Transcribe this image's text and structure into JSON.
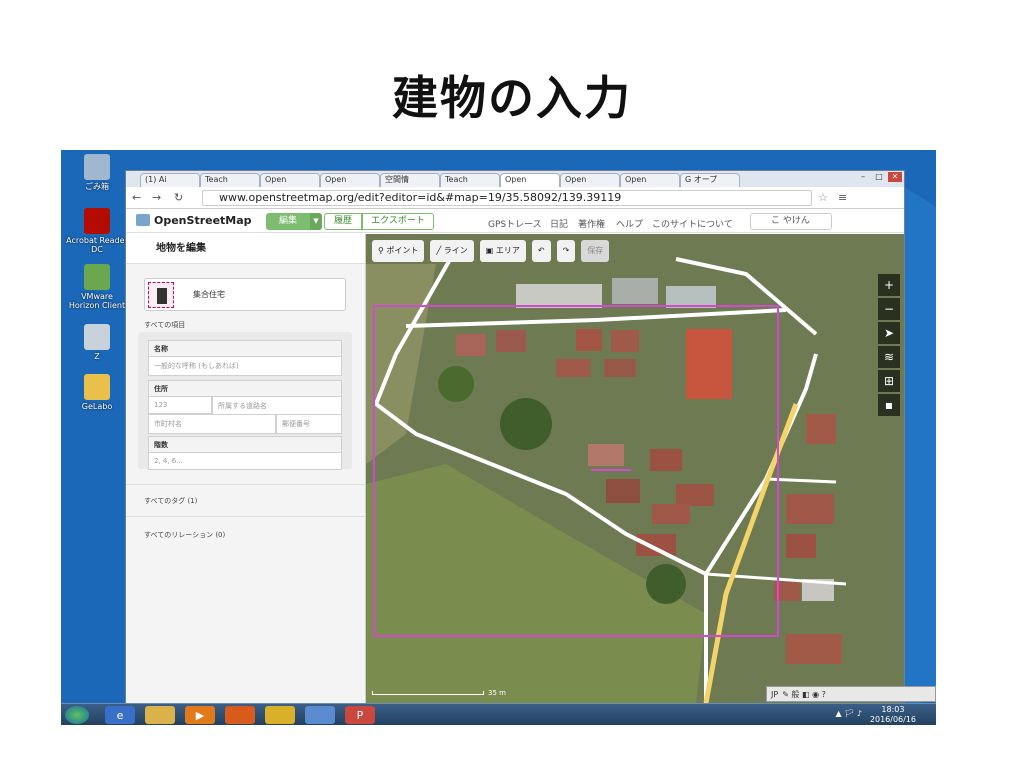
{
  "slide": {
    "title": "建物の入力"
  },
  "desktop": {
    "icons": [
      {
        "label": "ごみ箱",
        "icon": "recycle-bin-icon",
        "color": "#9fb8d0"
      },
      {
        "label": "Acrobat Reader DC",
        "icon": "acrobat-icon",
        "color": "#b30b00"
      },
      {
        "label": "VMware Horizon Client",
        "icon": "vmware-icon",
        "color": "#6aa84f"
      },
      {
        "label": "Z",
        "icon": "network-drive-icon",
        "color": "#c9d2da"
      },
      {
        "label": "GeLabo",
        "icon": "folder-icon",
        "color": "#e8c04a"
      }
    ]
  },
  "taskbar": {
    "clock_time": "18:03",
    "clock_date": "2016/06/16",
    "tray_text": "▲ 🏳 ♪",
    "ime_label": "JP"
  },
  "browser": {
    "tabs": [
      {
        "label": "(1) Ai"
      },
      {
        "label": "Teach"
      },
      {
        "label": "Open"
      },
      {
        "label": "Open"
      },
      {
        "label": "空間情"
      },
      {
        "label": "Teach"
      },
      {
        "label": "Open"
      },
      {
        "label": "Open"
      },
      {
        "label": "Open"
      },
      {
        "label": "G オープ"
      }
    ],
    "url": "www.openstreetmap.org/edit?editor=id&#map=19/35.58092/139.39119"
  },
  "osm": {
    "logo": "OpenStreetMap",
    "edit_label": "編集",
    "history_label": "履歴",
    "export_label": "エクスポート",
    "links": [
      "GPSトレース",
      "日記",
      "著作権",
      "ヘルプ",
      "このサイトについて"
    ],
    "user": "こ やけん"
  },
  "sidebar": {
    "header": "地物を編集",
    "preset": "集合住宅",
    "all_fields": "すべての項目",
    "name_label": "名称",
    "name_placeholder": "一般的な呼称 (もしあれば)",
    "address_label": "住所",
    "housenumber_placeholder": "123",
    "street_placeholder": "所属する道路名",
    "city_placeholder": "市町村名",
    "postcode_placeholder": "郵便番号",
    "levels_label": "階数",
    "levels_placeholder": "2, 4, 6...",
    "all_tags": "すべてのタグ (1)",
    "all_relations": "すべてのリレーション (0)"
  },
  "map": {
    "toolbar": {
      "point": "ポイント",
      "line": "ライン",
      "area": "エリア",
      "save": "保存"
    },
    "scale": "35 m"
  }
}
